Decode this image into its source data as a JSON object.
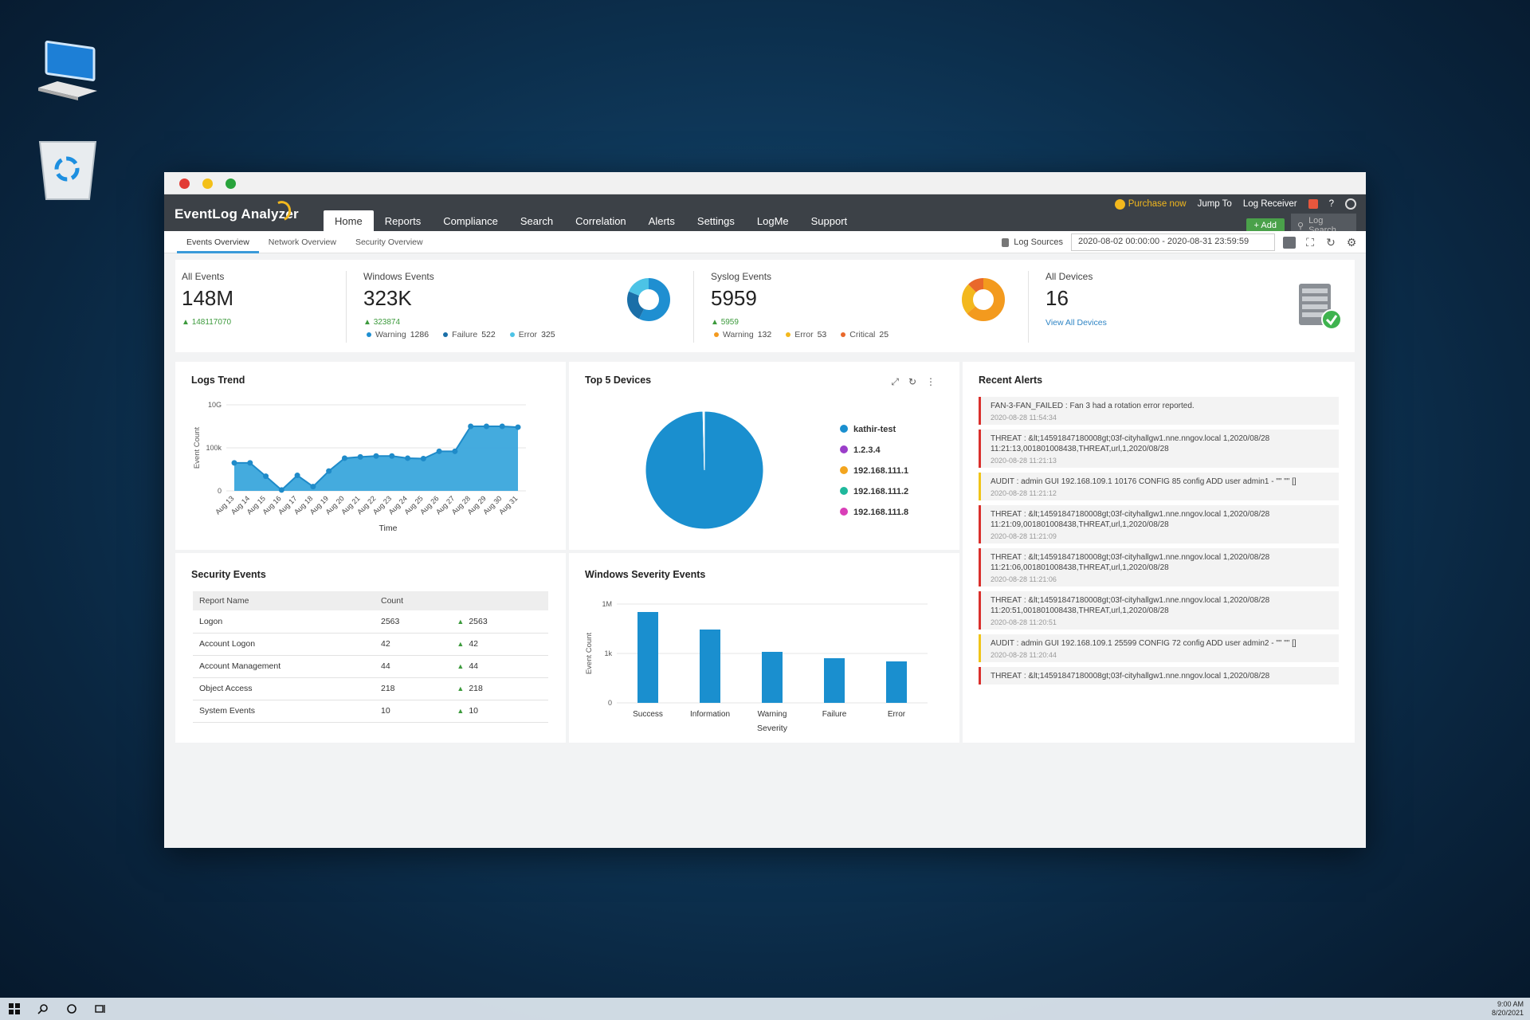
{
  "app": {
    "brand": "EventLog Analyzer",
    "nav": [
      "Home",
      "Reports",
      "Compliance",
      "Search",
      "Correlation",
      "Alerts",
      "Settings",
      "LogMe",
      "Support"
    ],
    "active_nav": 0,
    "purchase": "Purchase now",
    "jump_to": "Jump To",
    "log_receiver": "Log Receiver",
    "help": "?",
    "add_button": "Add",
    "log_search_placeholder": "Log Search"
  },
  "subnav": {
    "tabs": [
      "Events Overview",
      "Network Overview",
      "Security Overview"
    ],
    "active": 0,
    "log_sources": "Log Sources",
    "date_range": "2020-08-02 00:00:00 - 2020-08-31 23:59:59"
  },
  "stats": {
    "all_events": {
      "label": "All Events",
      "value": "148M",
      "delta": "148117070"
    },
    "windows_events": {
      "label": "Windows Events",
      "value": "323K",
      "delta": "323874",
      "legend": [
        {
          "name": "Warning",
          "value": "1286",
          "color": "#1f8fd1"
        },
        {
          "name": "Failure",
          "value": "522",
          "color": "#1a6fa8"
        },
        {
          "name": "Error",
          "value": "325",
          "color": "#4cc3e6"
        }
      ]
    },
    "syslog_events": {
      "label": "Syslog Events",
      "value": "5959",
      "delta": "5959",
      "legend": [
        {
          "name": "Warning",
          "value": "132",
          "color": "#f39a1e"
        },
        {
          "name": "Error",
          "value": "53",
          "color": "#f3b81d"
        },
        {
          "name": "Critical",
          "value": "25",
          "color": "#e9682b"
        }
      ]
    },
    "all_devices": {
      "label": "All Devices",
      "value": "16",
      "link": "View All Devices"
    }
  },
  "logs_trend": {
    "title": "Logs Trend",
    "chart_data": {
      "type": "area",
      "title": "Logs Trend",
      "xlabel": "Time",
      "ylabel": "Event Count",
      "yticks": [
        "10G",
        "100k",
        "0"
      ],
      "categories": [
        "Aug 13",
        "Aug 14",
        "Aug 15",
        "Aug 16",
        "Aug 17",
        "Aug 18",
        "Aug 19",
        "Aug 20",
        "Aug 21",
        "Aug 22",
        "Aug 23",
        "Aug 24",
        "Aug 25",
        "Aug 26",
        "Aug 27",
        "Aug 28",
        "Aug 29",
        "Aug 30",
        "Aug 31"
      ],
      "values": [
        0.65,
        0.65,
        0.34,
        0.02,
        0.36,
        0.1,
        0.46,
        0.76,
        0.79,
        0.81,
        0.81,
        0.76,
        0.75,
        0.92,
        0.92,
        1.5,
        1.5,
        1.5,
        1.48
      ],
      "ylim": [
        0,
        2
      ]
    }
  },
  "top_devices": {
    "title": "Top 5 Devices",
    "chart_data": {
      "type": "pie",
      "title": "Top 5 Devices",
      "labels": [
        "kathir-test",
        "1.2.3.4",
        "192.168.111.1",
        "192.168.111.2",
        "192.168.111.8"
      ],
      "values": [
        99.6,
        0.1,
        0.1,
        0.1,
        0.1
      ],
      "colors": [
        "#1a8fcf",
        "#9b3ec9",
        "#f3a51e",
        "#1fb89c",
        "#d93fb8"
      ]
    }
  },
  "security_events": {
    "title": "Security Events",
    "headers": [
      "Report Name",
      "Count"
    ],
    "rows": [
      {
        "name": "Logon",
        "count": "2563",
        "delta": "2563"
      },
      {
        "name": "Account Logon",
        "count": "42",
        "delta": "42"
      },
      {
        "name": "Account Management",
        "count": "44",
        "delta": "44"
      },
      {
        "name": "Object Access",
        "count": "218",
        "delta": "218"
      },
      {
        "name": "System Events",
        "count": "10",
        "delta": "10"
      }
    ]
  },
  "windows_severity": {
    "title": "Windows Severity Events",
    "chart_data": {
      "type": "bar",
      "title": "Windows Severity Events",
      "xlabel": "Severity",
      "ylabel": "Event Count",
      "yticks": [
        "1M",
        "1k",
        "0"
      ],
      "categories": [
        "Success",
        "Information",
        "Warning",
        "Failure",
        "Error"
      ],
      "values": [
        2.85,
        2.3,
        1.6,
        1.4,
        1.3
      ],
      "ylim": [
        0,
        3.1
      ]
    }
  },
  "recent_alerts": {
    "title": "Recent Alerts",
    "items": [
      {
        "level": "critical",
        "msg": "FAN-3-FAN_FAILED : Fan 3 had a rotation error reported.",
        "time": "2020-08-28 11:54:34"
      },
      {
        "level": "critical",
        "msg": "THREAT : &lt;14591847180008gt;03f-cityhallgw1.nne.nngov.local 1,2020/08/28 11:21:13,001801008438,THREAT,url,1,2020/08/28",
        "time": "2020-08-28 11:21:13"
      },
      {
        "level": "warning",
        "msg": "AUDIT : admin GUI 192.168.109.1 10176 CONFIG 85 config ADD user admin1 - \"\" \"\" []",
        "time": "2020-08-28 11:21:12"
      },
      {
        "level": "critical",
        "msg": "THREAT : &lt;14591847180008gt;03f-cityhallgw1.nne.nngov.local 1,2020/08/28 11:21:09,001801008438,THREAT,url,1,2020/08/28",
        "time": "2020-08-28 11:21:09"
      },
      {
        "level": "critical",
        "msg": "THREAT : &lt;14591847180008gt;03f-cityhallgw1.nne.nngov.local 1,2020/08/28 11:21:06,001801008438,THREAT,url,1,2020/08/28",
        "time": "2020-08-28 11:21:06"
      },
      {
        "level": "critical",
        "msg": "THREAT : &lt;14591847180008gt;03f-cityhallgw1.nne.nngov.local 1,2020/08/28 11:20:51,001801008438,THREAT,url,1,2020/08/28",
        "time": "2020-08-28 11:20:51"
      },
      {
        "level": "warning",
        "msg": "AUDIT : admin GUI 192.168.109.1 25599 CONFIG 72 config ADD user admin2 - \"\" \"\" []",
        "time": "2020-08-28 11:20:44"
      },
      {
        "level": "critical",
        "msg": "THREAT : &lt;14591847180008gt;03f-cityhallgw1.nne.nngov.local 1,2020/08/28",
        "time": ""
      }
    ]
  },
  "taskbar": {
    "time": "9:00 AM",
    "date": "8/20/2021"
  }
}
